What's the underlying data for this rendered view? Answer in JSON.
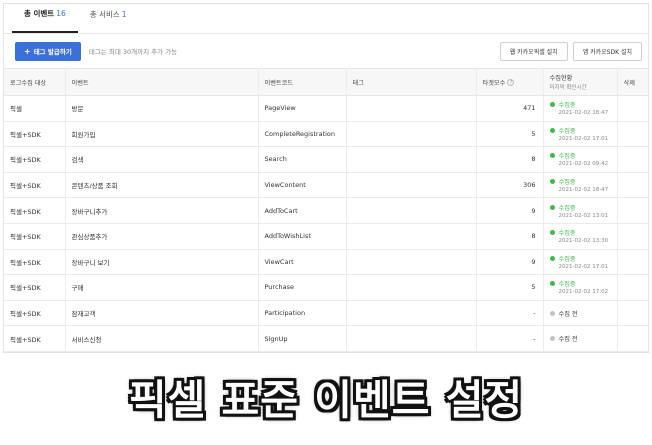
{
  "tabs": [
    {
      "label": "총 이벤트",
      "count": "16",
      "active": true
    },
    {
      "label": "총 서비스",
      "count": "1",
      "active": false
    }
  ],
  "toolbar": {
    "add_tag_label": "태그 발급하기",
    "hint": "태그는 최대 30개까지 추가 가능",
    "app_pixel_label": "웹 카카오픽셀 설치",
    "app_sdk_label": "앱 카카오SDK 설치"
  },
  "table": {
    "headers": {
      "target": "로그수집 대상",
      "event": "이벤트",
      "code": "이벤트코드",
      "tag": "태그",
      "count": "타겟모수",
      "status": "수집현황",
      "status_sub": "마지막 확인시간",
      "delete": "삭제"
    },
    "rows": [
      {
        "target": "픽셀",
        "event": "방문",
        "code": "PageView",
        "tag": "",
        "count": "471",
        "status": "수집중",
        "time": "2021-02-02 18:47",
        "active": true
      },
      {
        "target": "픽셀+SDK",
        "event": "회원가입",
        "code": "CompleteRegistration",
        "tag": "",
        "count": "5",
        "status": "수집중",
        "time": "2021-02-02 17:01",
        "active": true
      },
      {
        "target": "픽셀+SDK",
        "event": "검색",
        "code": "Search",
        "tag": "",
        "count": "8",
        "status": "수집중",
        "time": "2021-02-02 09:42",
        "active": true
      },
      {
        "target": "픽셀+SDK",
        "event": "콘텐츠/상품 조회",
        "code": "ViewContent",
        "tag": "",
        "count": "306",
        "status": "수집중",
        "time": "2021-02-02 18:47",
        "active": true
      },
      {
        "target": "픽셀+SDK",
        "event": "장바구니추가",
        "code": "AddToCart",
        "tag": "",
        "count": "9",
        "status": "수집중",
        "time": "2021-02-02 13:01",
        "active": true
      },
      {
        "target": "픽셀+SDK",
        "event": "관심상품추가",
        "code": "AddToWishList",
        "tag": "",
        "count": "8",
        "status": "수집중",
        "time": "2021-02-02 13:30",
        "active": true
      },
      {
        "target": "픽셀+SDK",
        "event": "장바구니 보기",
        "code": "ViewCart",
        "tag": "",
        "count": "9",
        "status": "수집중",
        "time": "2021-02-02 17:01",
        "active": true
      },
      {
        "target": "픽셀+SDK",
        "event": "구매",
        "code": "Purchase",
        "tag": "",
        "count": "5",
        "status": "수집중",
        "time": "2021-02-02 17:02",
        "active": true
      },
      {
        "target": "픽셀+SDK",
        "event": "잠재고객",
        "code": "Participation",
        "tag": "",
        "count": "-",
        "status": "수집 전",
        "time": "",
        "active": false
      },
      {
        "target": "픽셀+SDK",
        "event": "서비스신청",
        "code": "SignUp",
        "tag": "",
        "count": "-",
        "status": "수집 전",
        "time": "",
        "active": false
      }
    ]
  },
  "colors": {
    "active_dot": "#3fb84a",
    "inactive_dot": "#c4c4c4",
    "accent": "#3b6fd9"
  },
  "caption": "픽셀 표준 이벤트 설정"
}
